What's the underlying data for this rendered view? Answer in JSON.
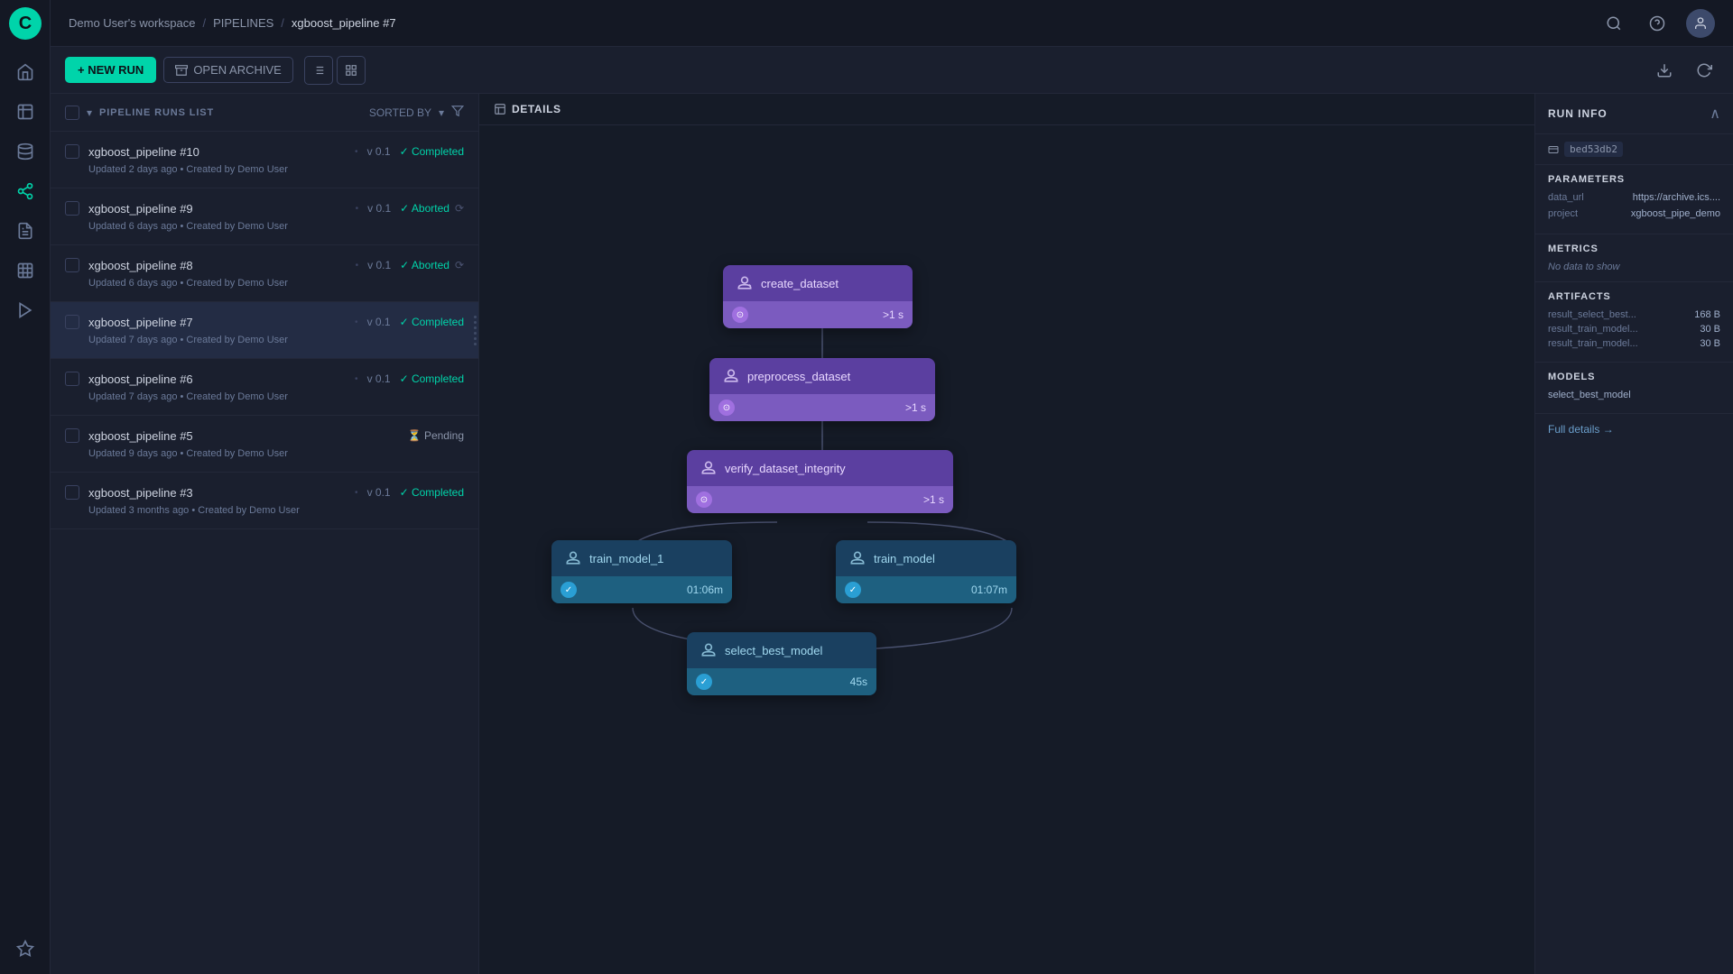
{
  "app": {
    "logo": "C"
  },
  "breadcrumb": {
    "workspace": "Demo User's workspace",
    "section": "PIPELINES",
    "current": "xgboost_pipeline #7"
  },
  "toolbar": {
    "new_run_label": "+ NEW RUN",
    "open_archive_label": "OPEN ARCHIVE",
    "view_list_label": "≡",
    "view_grid_label": "▦"
  },
  "runs_panel": {
    "header_label": "PIPELINE RUNS LIST",
    "sorted_by_label": "SORTED BY",
    "runs": [
      {
        "id": 0,
        "name": "xgboost_pipeline #10",
        "version": "v 0.1",
        "status": "Completed",
        "status_type": "completed",
        "meta": "Updated 2 days ago • Created by Demo User"
      },
      {
        "id": 1,
        "name": "xgboost_pipeline #9",
        "version": "v 0.1",
        "status": "Aborted",
        "status_type": "aborted",
        "meta": "Updated 6 days ago • Created by Demo User"
      },
      {
        "id": 2,
        "name": "xgboost_pipeline #8",
        "version": "v 0.1",
        "status": "Aborted",
        "status_type": "aborted",
        "meta": "Updated 6 days ago • Created by Demo User"
      },
      {
        "id": 3,
        "name": "xgboost_pipeline #7",
        "version": "v 0.1",
        "status": "Completed",
        "status_type": "completed",
        "meta": "Updated 7 days ago • Created by Demo User",
        "selected": true
      },
      {
        "id": 4,
        "name": "xgboost_pipeline #6",
        "version": "v 0.1",
        "status": "Completed",
        "status_type": "completed",
        "meta": "Updated 7 days ago • Created by Demo User"
      },
      {
        "id": 5,
        "name": "xgboost_pipeline #5",
        "version": "",
        "status": "Pending",
        "status_type": "pending",
        "meta": "Updated 9 days ago • Created by Demo User"
      },
      {
        "id": 6,
        "name": "xgboost_pipeline #3",
        "version": "v 0.1",
        "status": "Completed",
        "status_type": "completed",
        "meta": "Updated 3 months ago • Created by Demo User"
      }
    ]
  },
  "details_tab": {
    "label": "DETAILS"
  },
  "pipeline_nodes": {
    "create_dataset": {
      "name": "create_dataset",
      "time": ">1 s",
      "type": "purple"
    },
    "preprocess_dataset": {
      "name": "preprocess_dataset",
      "time": ">1 s",
      "type": "purple"
    },
    "verify_dataset_integrity": {
      "name": "verify_dataset_integrity",
      "time": ">1 s",
      "type": "purple"
    },
    "train_model_1": {
      "name": "train_model_1",
      "time": "01:06m",
      "type": "teal"
    },
    "train_model": {
      "name": "train_model",
      "time": "01:07m",
      "type": "teal"
    },
    "select_best_model": {
      "name": "select_best_model",
      "time": "45s",
      "type": "teal"
    }
  },
  "run_info": {
    "title": "RUN INFO",
    "id": "bed53db2",
    "parameters_title": "PARAMETERS",
    "parameters": [
      {
        "key": "data_url",
        "value": "https://archive.ics...."
      },
      {
        "key": "project",
        "value": "xgboost_pipe_demo"
      }
    ],
    "metrics_title": "METRICS",
    "metrics_no_data": "No data to show",
    "artifacts_title": "ARTIFACTS",
    "artifacts": [
      {
        "key": "result_select_best...",
        "value": "168 B"
      },
      {
        "key": "result_train_model...",
        "value": "30 B"
      },
      {
        "key": "result_train_model...",
        "value": "30 B"
      }
    ],
    "models_title": "MODELS",
    "models": [
      {
        "name": "select_best_model"
      }
    ],
    "full_details_label": "Full details →"
  },
  "nav_icons": [
    {
      "name": "home-icon",
      "symbol": "⌂"
    },
    {
      "name": "experiment-icon",
      "symbol": "⚗"
    },
    {
      "name": "dataset-icon",
      "symbol": "◫"
    },
    {
      "name": "pipeline-icon",
      "symbol": "⋮"
    },
    {
      "name": "report-icon",
      "symbol": "📋"
    },
    {
      "name": "table-icon",
      "symbol": "▦"
    },
    {
      "name": "forward-icon",
      "symbol": "▶"
    },
    {
      "name": "plugin-icon",
      "symbol": "✦"
    }
  ]
}
